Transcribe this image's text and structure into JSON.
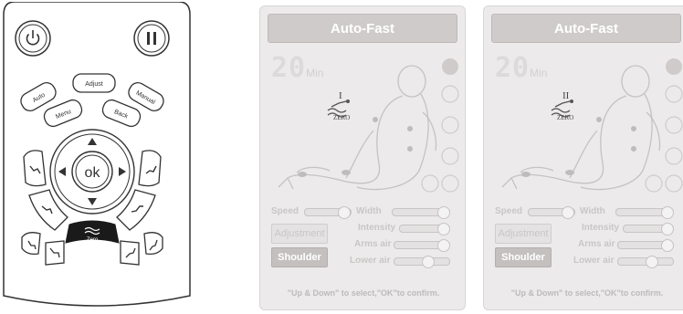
{
  "remote": {
    "buttons": {
      "auto": "Auto",
      "adjust": "Adjust",
      "manual": "Manual",
      "menu": "Menu",
      "back": "Back",
      "ok": "ok",
      "zero": "Zero"
    }
  },
  "panels": [
    {
      "header": "Auto-Fast",
      "timer_value": "20",
      "timer_unit": "Min",
      "zero_level": "I",
      "zero_label": "ZERO",
      "labels": {
        "speed": "Speed",
        "width": "Width",
        "intensity": "Intensity",
        "arms_air": "Arms air",
        "lower_air": "Lower air"
      },
      "buttons": {
        "adjustment": "Adjustment",
        "shoulder": "Shoulder"
      },
      "hint": "\"Up & Down\" to select,\"OK\"to confirm."
    },
    {
      "header": "Auto-Fast",
      "timer_value": "20",
      "timer_unit": "Min",
      "zero_level": "II",
      "zero_label": "ZERO",
      "labels": {
        "speed": "Speed",
        "width": "Width",
        "intensity": "Intensity",
        "arms_air": "Arms air",
        "lower_air": "Lower air"
      },
      "buttons": {
        "adjustment": "Adjustment",
        "shoulder": "Shoulder"
      },
      "hint": "\"Up & Down\" to select,\"OK\"to confirm."
    }
  ]
}
